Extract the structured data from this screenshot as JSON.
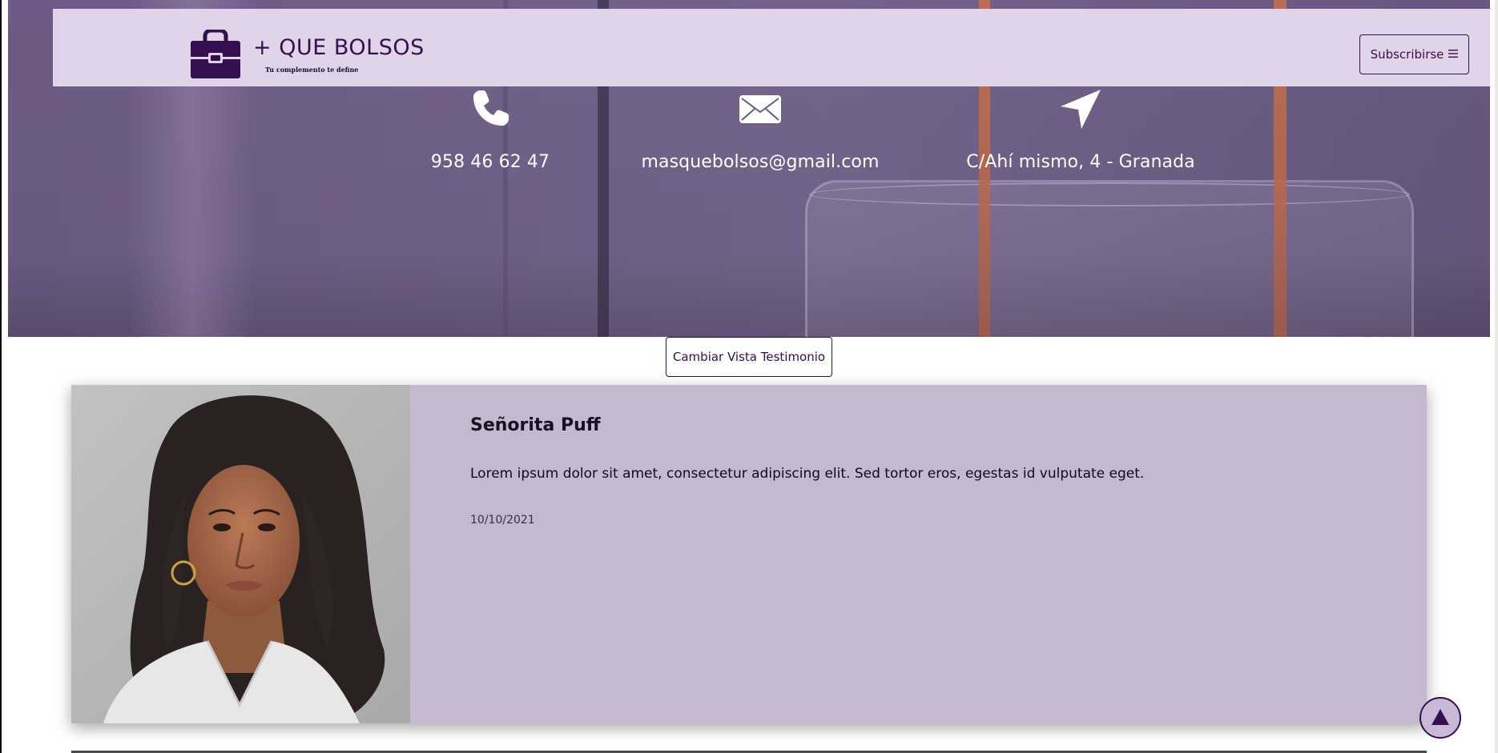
{
  "header": {
    "brand_title": "+ QUE BOLSOS",
    "brand_tagline": "Tu complemento te define",
    "logo_icon": "bag-icon",
    "subscribe_label": "Subscribirse",
    "menu_icon": "hamburger-icon"
  },
  "contact": {
    "phone": {
      "icon": "phone-icon",
      "text": "958 46 62 47"
    },
    "email": {
      "icon": "envelope-icon",
      "text": "masquebolsos@gmail.com"
    },
    "address": {
      "icon": "location-arrow-icon",
      "text": "C/Ahí mismo, 4 - Granada"
    }
  },
  "testimonials": {
    "toggle_label": "Cambiar Vista Testimonio",
    "items": [
      {
        "name": "Señorita Puff",
        "quote": "Lorem ipsum dolor sit amet, consectetur adipiscing elit. Sed tortor eros, egestas id vulputate eget.",
        "date": "10/10/2021",
        "photo": "woman-portrait"
      }
    ]
  },
  "back_to_top": {
    "icon": "up-arrow-icon",
    "symbol": "▲"
  },
  "colors": {
    "brand_purple": "#35104f",
    "header_bg": "#e1d3e8",
    "card_bg": "#c5b9cf",
    "hero_bg": "#6b5a82"
  }
}
